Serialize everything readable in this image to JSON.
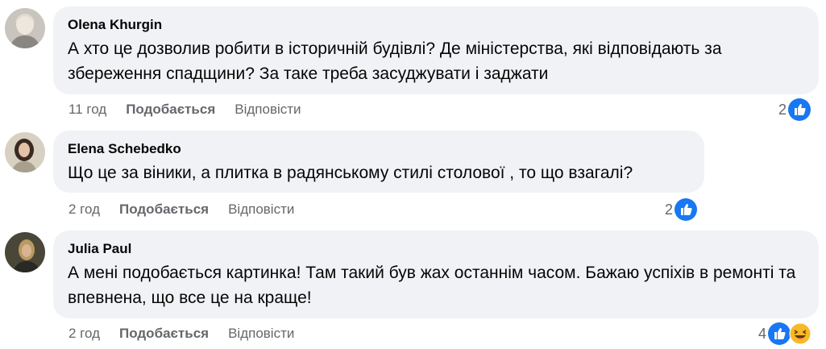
{
  "comments": [
    {
      "author": "Olena Khurgin",
      "text": "А хто це дозволив робити в історичній будівлі? Де міністерства, які відповідають за збереження спадщини? За таке треба засуджувати і заджати",
      "time": "11 год",
      "like_label": "Подобається",
      "reply_label": "Відповісти",
      "reaction_count": "2",
      "reactions": [
        "like-icon"
      ]
    },
    {
      "author": "Elena Schebedko",
      "text": "Що це за віники, а плитка в радянському стилі столової , то що взагалі?",
      "time": "2 год",
      "like_label": "Подобається",
      "reply_label": "Відповісти",
      "reaction_count": "2",
      "reactions": [
        "like-icon"
      ]
    },
    {
      "author": "Julia Paul",
      "text": "А мені подобається картинка! Там такий був жах останнім часом. Бажаю успіхів в ремонті та впевнена, що все це на краще!",
      "time": "2 год",
      "like_label": "Подобається",
      "reply_label": "Відповісти",
      "reaction_count": "4",
      "reactions": [
        "like-icon",
        "haha-icon"
      ]
    }
  ],
  "colors": {
    "bubble": "#f0f2f5",
    "meta_text": "#65676b",
    "like_blue": "#1877f2",
    "haha_yellow": "#f7b928"
  }
}
